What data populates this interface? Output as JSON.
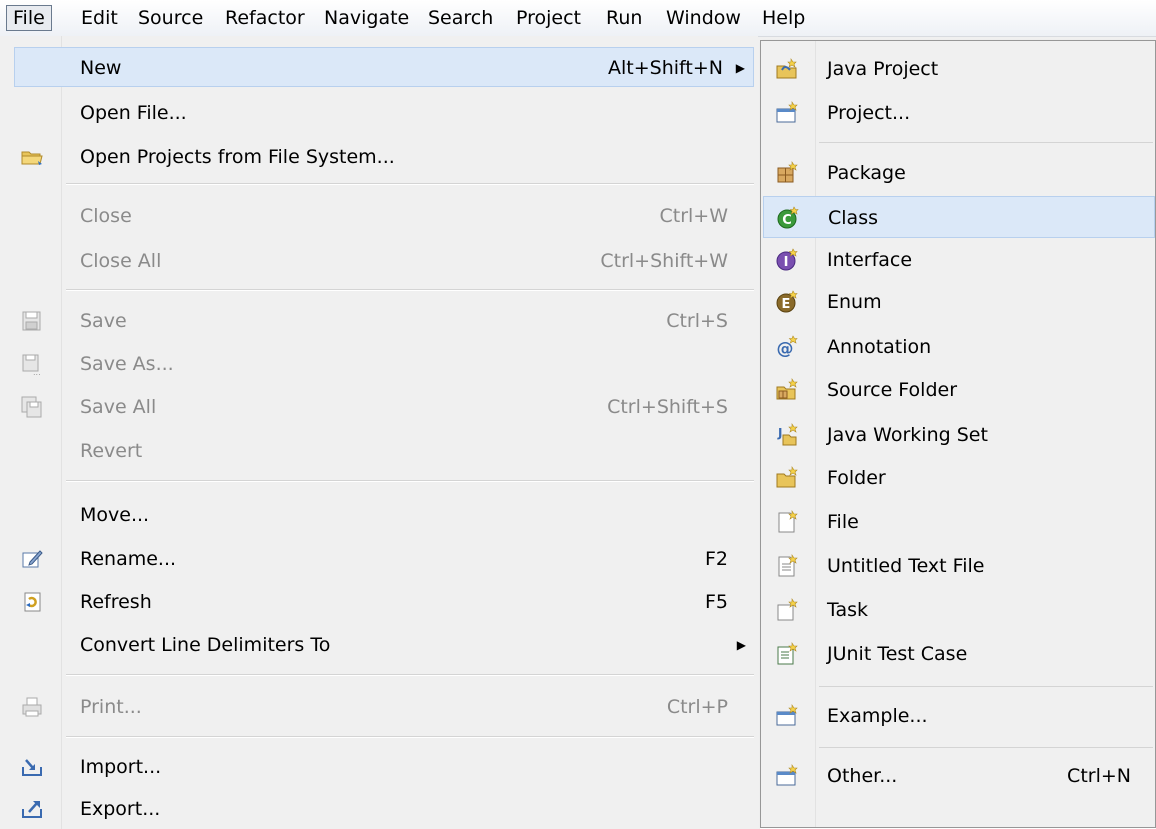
{
  "menubar": {
    "items": [
      "File",
      "Edit",
      "Source",
      "Refactor",
      "Navigate",
      "Search",
      "Project",
      "Run",
      "Window",
      "Help"
    ]
  },
  "file_menu": {
    "new": {
      "label": "New",
      "accel": "Alt+Shift+N"
    },
    "open_file": {
      "label": "Open File..."
    },
    "open_projects": {
      "label": "Open Projects from File System..."
    },
    "close": {
      "label": "Close",
      "accel": "Ctrl+W"
    },
    "close_all": {
      "label": "Close All",
      "accel": "Ctrl+Shift+W"
    },
    "save": {
      "label": "Save",
      "accel": "Ctrl+S"
    },
    "save_as": {
      "label": "Save As..."
    },
    "save_all": {
      "label": "Save All",
      "accel": "Ctrl+Shift+S"
    },
    "revert": {
      "label": "Revert"
    },
    "move": {
      "label": "Move..."
    },
    "rename": {
      "label": "Rename...",
      "accel": "F2"
    },
    "refresh": {
      "label": "Refresh",
      "accel": "F5"
    },
    "convert": {
      "label": "Convert Line Delimiters To"
    },
    "print": {
      "label": "Print...",
      "accel": "Ctrl+P"
    },
    "import": {
      "label": "Import..."
    },
    "export": {
      "label": "Export..."
    }
  },
  "submenu": {
    "java_project": "Java Project",
    "project": "Project...",
    "package": "Package",
    "class": "Class",
    "interface": "Interface",
    "enum": "Enum",
    "annotation": "Annotation",
    "source_folder": "Source Folder",
    "java_working_set": "Java Working Set",
    "folder": "Folder",
    "file": "File",
    "untitled_text_file": "Untitled Text File",
    "task": "Task",
    "junit_test_case": "JUnit Test Case",
    "example": "Example...",
    "other": {
      "label": "Other...",
      "accel": "Ctrl+N"
    }
  },
  "colors": {
    "highlight": "#dbe8f8",
    "highlight_border": "#b8d0ee",
    "disabled_text": "#8a8a8a",
    "class_icon": "#3b9a3b",
    "interface_icon": "#7a4fb0",
    "enum_icon": "#8a6a2a"
  }
}
